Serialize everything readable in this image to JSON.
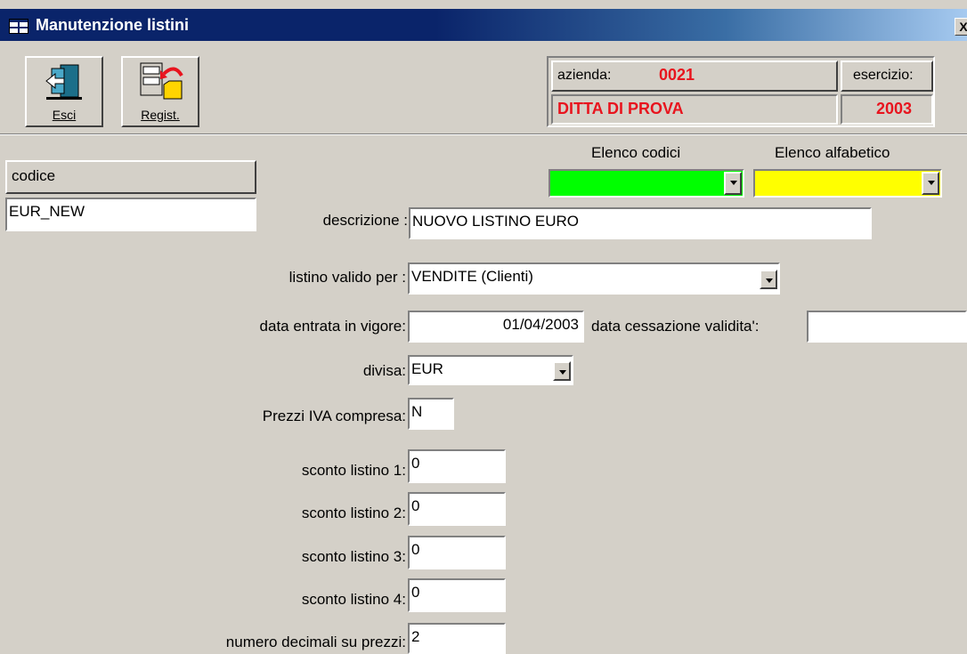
{
  "window": {
    "title": "Manutenzione listini",
    "close_label": "X"
  },
  "toolbar": {
    "esci_label": "Esci",
    "registra_label": "Regist."
  },
  "company": {
    "azienda_label": "azienda:",
    "azienda_code": "0021",
    "azienda_name": "DITTA DI PROVA",
    "esercizio_label": "esercizio:",
    "esercizio_value": "2003"
  },
  "codice": {
    "label": "codice",
    "value": "EUR_NEW"
  },
  "lookups": {
    "codici_label": "Elenco codici",
    "codici_color": "#00ff00",
    "alfabetico_label": "Elenco alfabetico",
    "alfabetico_color": "#ffff00"
  },
  "form": {
    "descrizione_label": "descrizione :",
    "descrizione_value": "NUOVO LISTINO EURO",
    "listino_label": "listino valido per :",
    "listino_value": "VENDITE (Clienti)",
    "data_entrata_label": "data entrata in vigore:",
    "data_entrata_value": "01/04/2003",
    "data_cessazione_label": "data cessazione validita':",
    "data_cessazione_value": "",
    "divisa_label": "divisa:",
    "divisa_value": "EUR",
    "iva_label": "Prezzi IVA compresa:",
    "iva_value": "N",
    "sconti": [
      {
        "label": "sconto listino 1:",
        "value": "0"
      },
      {
        "label": "sconto listino 2:",
        "value": "0"
      },
      {
        "label": "sconto listino 3:",
        "value": "0"
      },
      {
        "label": "sconto listino 4:",
        "value": "0"
      }
    ],
    "decimali_label": "numero decimali su prezzi:",
    "decimali_value": "2"
  }
}
